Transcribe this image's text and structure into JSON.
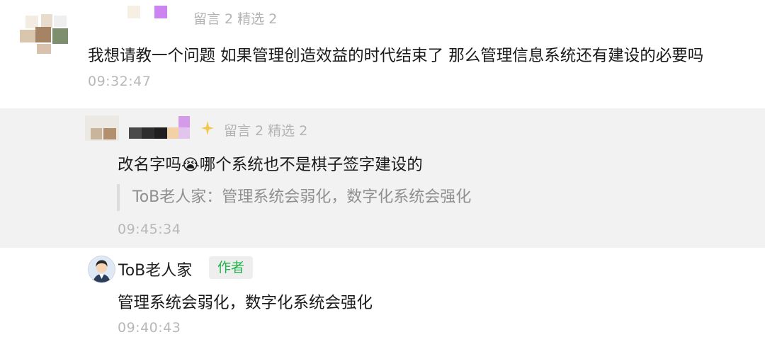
{
  "comment": {
    "stats": "留言 2 精选 2",
    "text": "我想请教一个问题 如果管理创造效益的时代结束了 那么管理信息系统还有建设的必要吗",
    "time": "09:32:47"
  },
  "reply": {
    "stats": "留言 2 精选 2",
    "text_before_emoji": "改名字吗",
    "emoji": "😭",
    "text_after_emoji": "哪个系统也不是棋子签字建设的",
    "quote": "ToB老人家：管理系统会弱化，数字化系统会强化",
    "time": "09:45:34"
  },
  "author_reply": {
    "name": "ToB老人家",
    "badge": "作者",
    "text": "管理系统会弱化，数字化系统会强化",
    "time": "09:40:43"
  },
  "colors": {
    "badge_green": "#21b04b",
    "reply_background": "#f2f2f2"
  }
}
